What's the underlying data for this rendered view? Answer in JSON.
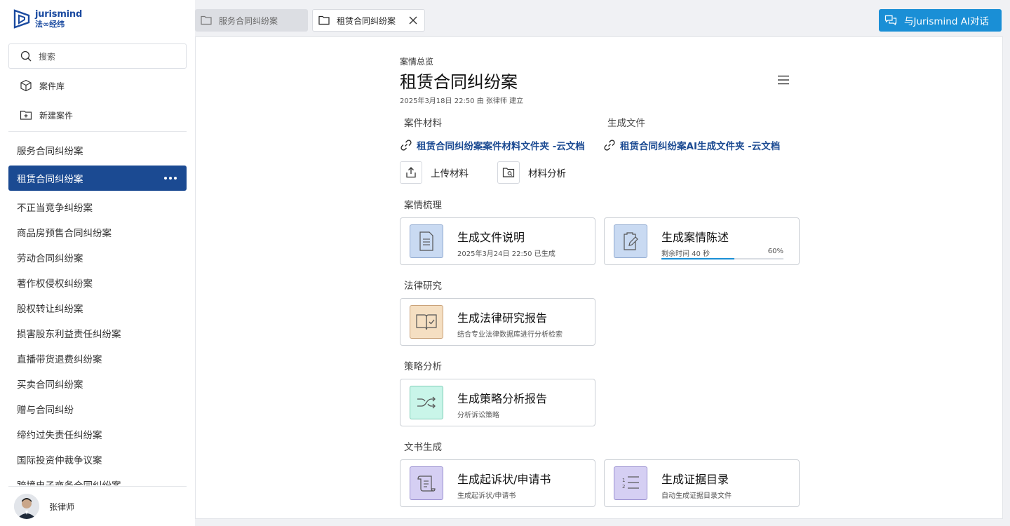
{
  "app": {
    "logo_en": "jurismind",
    "logo_cn": "法∞经纬"
  },
  "sidebar": {
    "search_placeholder": "搜索",
    "case_library": "案件库",
    "new_case": "新建案件",
    "cases": [
      "服务合同纠纷案",
      "租赁合同纠纷案",
      "不正当竞争纠纷案",
      "商品房预售合同纠纷案",
      "劳动合同纠纷案",
      "著作权侵权纠纷案",
      "股权转让纠纷案",
      "损害股东利益责任纠纷案",
      "直播带货退费纠纷案",
      "买卖合同纠纷案",
      "赠与合同纠纷",
      "缔约过失责任纠纷案",
      "国际投资仲裁争议案",
      "跨境电子商务合同纠纷案"
    ],
    "active_index": 1,
    "user_name": "张律师"
  },
  "tabs": [
    {
      "label": "服务合同纠纷案",
      "active": false
    },
    {
      "label": "租赁合同纠纷案",
      "active": true
    }
  ],
  "ai_button": "与Jurismind AI对话",
  "overview": {
    "label": "案情总览",
    "title": "租赁合同纠纷案",
    "meta": "2025年3月18日 22:50 由 张律师 建立"
  },
  "materials": {
    "label": "案件材料",
    "link": "租赁合同纠纷案案件材料文件夹 -云文档",
    "upload": "上传材料",
    "analyze": "材料分析"
  },
  "generated": {
    "label": "生成文件",
    "link": "租赁合同纠纷案AI生成文件夹 -云文档"
  },
  "sections": {
    "case_review": "案情梳理",
    "legal_research": "法律研究",
    "strategy": "策略分析",
    "doc_gen": "文书生成"
  },
  "cards": {
    "doc_explain": {
      "title": "生成文件说明",
      "sub": "2025年3月24日 22:50 已生成"
    },
    "case_statement": {
      "title": "生成案情陈述",
      "remaining": "剩余时间 40 秒",
      "progress_label": "60%",
      "progress": 0.6
    },
    "legal_report": {
      "title": "生成法律研究报告",
      "sub": "结合专业法律数据库进行分析检索"
    },
    "strategy_report": {
      "title": "生成策略分析报告",
      "sub": "分析诉讼策略"
    },
    "complaint": {
      "title": "生成起诉状/申请书",
      "sub": "生成起诉状/申请书"
    },
    "evidence": {
      "title": "生成证据目录",
      "sub": "自动生成证据目录文件"
    }
  },
  "colors": {
    "brand": "#1b4a92",
    "accent": "#1a8fd6",
    "icon_blue": "#c9daf2",
    "icon_orange": "#f5dfc2",
    "icon_teal": "#c9f5e9",
    "icon_purple": "#d5cff3"
  }
}
